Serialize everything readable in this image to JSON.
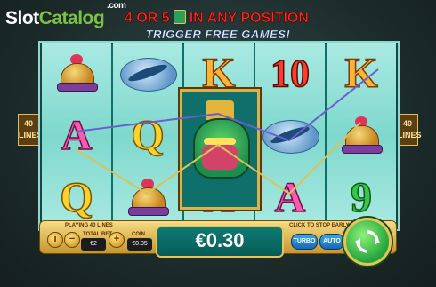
{
  "logo": {
    "slot": "Slot",
    "catalog": "Catalog",
    "com": ".com"
  },
  "banner": {
    "line1_a": "4 OR 5",
    "line1_b": "IN ANY POSITION",
    "line2": "TRIGGER FREE GAMES!"
  },
  "lines_badge": {
    "num": "40",
    "label": "LINES"
  },
  "reels": [
    [
      "helmet",
      "A",
      "Q"
    ],
    [
      "fish",
      "Q",
      "helmet"
    ],
    [
      "K",
      "dragon",
      "A"
    ],
    [
      "10",
      "fish",
      "A"
    ],
    [
      "K",
      "helmet",
      "9"
    ]
  ],
  "controls": {
    "playing_label": "PLAYING 40 LINES",
    "total_bet_label": "TOTAL BET",
    "total_bet_value": "€2",
    "coin_label": "COIN",
    "coin_value": "€0.05",
    "minus": "−",
    "plus": "+",
    "info": "i",
    "win_amount": "€0.30",
    "stop_hint": "CLICK TO STOP EARLY",
    "turbo_label": "TURBO",
    "auto_label": "AUTO"
  },
  "colors": {
    "accent": "#e7c55c",
    "reel_bg": "#8ed8cf",
    "win_bg": "#0d7a73",
    "spin": "#23a43a"
  }
}
